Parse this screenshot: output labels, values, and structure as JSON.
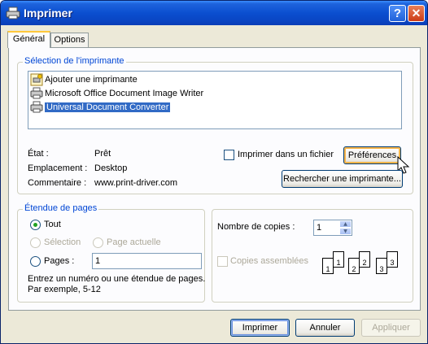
{
  "window": {
    "title": "Imprimer"
  },
  "tabs": [
    {
      "label": "Général"
    },
    {
      "label": "Options"
    }
  ],
  "printer_section": {
    "legend": "Sélection de l'imprimante",
    "printers": [
      {
        "name": "Ajouter une imprimante",
        "icon": "add-printer-icon"
      },
      {
        "name": "Microsoft Office Document Image Writer",
        "icon": "printer-icon"
      },
      {
        "name": "Universal Document Converter",
        "icon": "printer-icon",
        "selected": true
      }
    ],
    "status_label": "État :",
    "status_value": "Prêt",
    "location_label": "Emplacement :",
    "location_value": "Desktop",
    "comment_label": "Commentaire :",
    "comment_value": "www.print-driver.com",
    "print_to_file_label": "Imprimer dans un fichier",
    "preferences_label": "Préférences",
    "find_printer_label": "Rechercher une imprimante..."
  },
  "page_range": {
    "legend": "Étendue de pages",
    "all_label": "Tout",
    "selection_label": "Sélection",
    "current_page_label": "Page actuelle",
    "pages_label": "Pages :",
    "pages_value": "1",
    "hint_line1": "Entrez un numéro ou une étendue de pages.",
    "hint_line2": "Par exemple, 5-12"
  },
  "copies": {
    "count_label": "Nombre de copies :",
    "count_value": "1",
    "collate_label": "Copies assemblées",
    "collate_pages": [
      "1",
      "1",
      "2",
      "2",
      "3",
      "3"
    ]
  },
  "buttons": {
    "print": "Imprimer",
    "cancel": "Annuler",
    "apply": "Appliquer"
  }
}
